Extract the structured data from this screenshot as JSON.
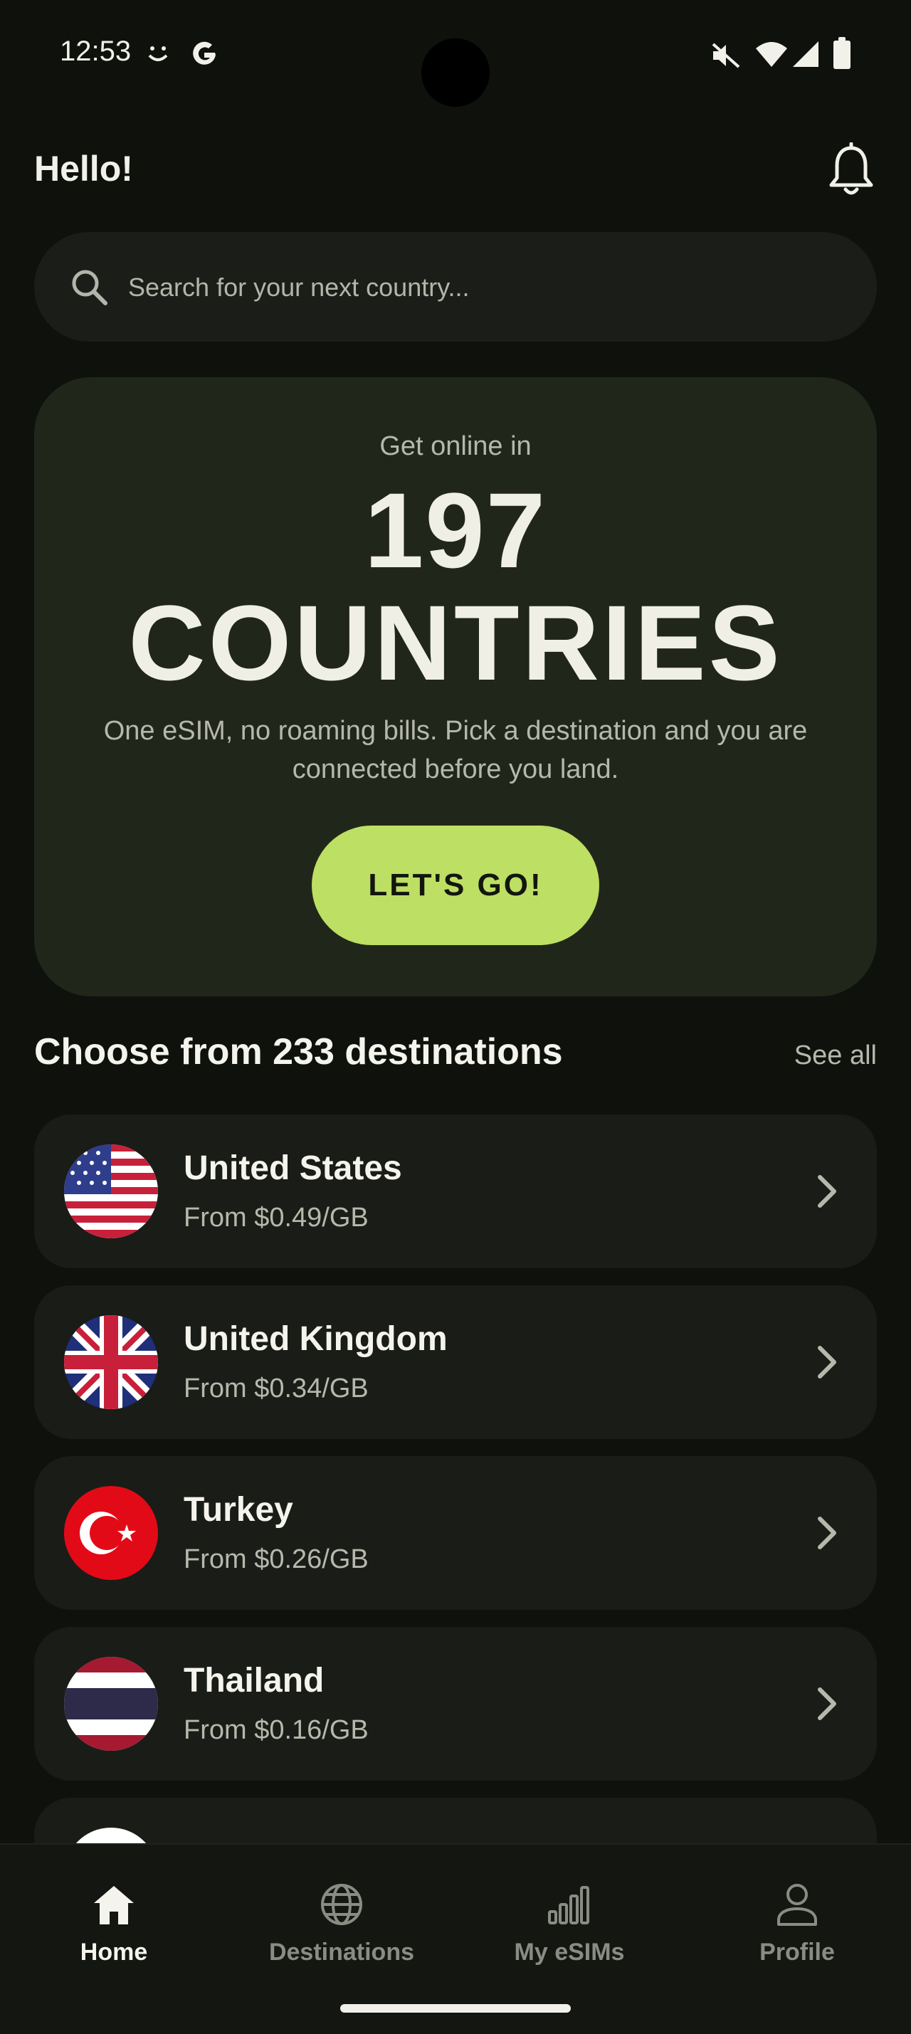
{
  "status_bar": {
    "time": "12:53"
  },
  "header": {
    "greeting": "Hello!"
  },
  "search": {
    "placeholder": "Search for your next country..."
  },
  "hero": {
    "kicker": "Get online in",
    "number": "197",
    "word": "COUNTRIES",
    "description": "One eSIM, no roaming bills. Pick a destination and you are connected before you land.",
    "button": "LET'S GO!"
  },
  "destinations": {
    "title": "Choose from 233 destinations",
    "see_all": "See all",
    "items": [
      {
        "name": "United States",
        "price": "From $0.49/GB"
      },
      {
        "name": "United Kingdom",
        "price": "From $0.34/GB"
      },
      {
        "name": "Turkey",
        "price": "From $0.26/GB"
      },
      {
        "name": "Thailand",
        "price": "From $0.16/GB"
      }
    ]
  },
  "nav": {
    "items": [
      {
        "label": "Home",
        "icon": "home-icon"
      },
      {
        "label": "Destinations",
        "icon": "globe-icon"
      },
      {
        "label": "My eSIMs",
        "icon": "signal-bars-icon"
      },
      {
        "label": "Profile",
        "icon": "person-icon"
      }
    ]
  },
  "colors": {
    "background": "#0f110d",
    "hero_card": "#20271a",
    "accent": "#bddf63",
    "card": "#1a1c18"
  }
}
